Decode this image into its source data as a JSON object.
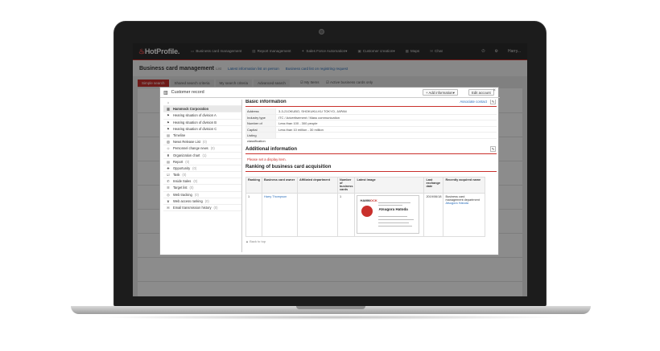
{
  "app": {
    "logo": "HotProfile.",
    "nav": [
      {
        "label": "Business card management"
      },
      {
        "label": "Report management"
      },
      {
        "label": "Sales Force Automation▾"
      },
      {
        "label": "Customer creation▾"
      },
      {
        "label": "Maps"
      },
      {
        "label": "Chat"
      }
    ],
    "user": "Harry..."
  },
  "page": {
    "title": "Business card management",
    "subtitle": "List",
    "link1": "Latest information list on person",
    "link2": "Business card list on registring request",
    "tabs": [
      "Simple search",
      "Shared search criteria",
      "My search criteria",
      "Advanced search"
    ],
    "check1": "My Items",
    "check2": "Active business cards only"
  },
  "modal": {
    "title": "Customer record",
    "add_button": "Add information▾",
    "edit_button": "Edit account",
    "sidebar": [
      {
        "label": "Hammock Corporation",
        "count": ""
      },
      {
        "label": "Hearing situation of division A",
        "count": ""
      },
      {
        "label": "Hearing situation of division B",
        "count": ""
      },
      {
        "label": "Hearing situation of division C",
        "count": ""
      },
      {
        "label": "Timeline",
        "count": ""
      },
      {
        "label": "News Release List",
        "count": "(0)"
      },
      {
        "label": "Personnel change news",
        "count": "(0)"
      },
      {
        "label": "Organization chart",
        "count": "(1)"
      },
      {
        "label": "Report",
        "count": "(0)"
      },
      {
        "label": "Opportunity",
        "count": "(0)"
      },
      {
        "label": "Task",
        "count": "(0)"
      },
      {
        "label": "Inside Sales",
        "count": "(0)"
      },
      {
        "label": "Target list",
        "count": "(0)"
      },
      {
        "label": "Web tracking",
        "count": "(0)"
      },
      {
        "label": "Web access ranking",
        "count": "(0)"
      },
      {
        "label": "Email transmission history",
        "count": "(0)"
      }
    ],
    "basic": {
      "heading": "Basic information",
      "associate": "Associate contact",
      "rows": [
        {
          "k": "Address",
          "v": "3-3-21OKUBO, SHOKUKU-KU TOKYO, JAPAN"
        },
        {
          "k": "Industry type",
          "v": "ITC / Advertisement / Mass communication"
        },
        {
          "k": "Number of employees",
          "v": "Less than 100 - 300 people"
        },
        {
          "k": "Capital",
          "v": "Less than 10 million - 30 million"
        },
        {
          "k": "Listing classification",
          "v": ""
        }
      ]
    },
    "additional": {
      "heading": "Additional information",
      "note": "Please set a display item."
    },
    "ranking": {
      "heading": "Ranking of business card acquisition",
      "columns": [
        "Ranking",
        "Business card owner",
        "Affiliated department",
        "Number of business cards",
        "Latest image",
        "Last exchange date",
        "Recently acquired name"
      ],
      "row": {
        "rank": "1",
        "owner": "Harry Thompson",
        "dept": "",
        "count": "1",
        "exchange_date": "2019/06/18",
        "recent_title": "Business card management department",
        "recent_name": "Atsugora Hatoda"
      },
      "card": {
        "logo1": "HAMM",
        "logo2": "OCK",
        "name": "Atsugora Hatoda"
      }
    },
    "back_to_top": "▲ Back to top"
  }
}
